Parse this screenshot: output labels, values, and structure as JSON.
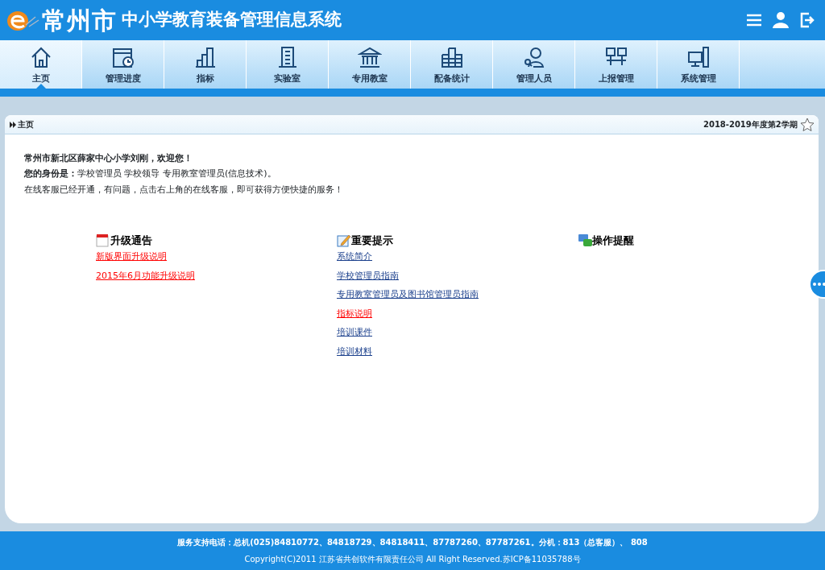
{
  "header": {
    "logo_text": "常州市",
    "title": "中小学教育装备管理信息系统"
  },
  "tabs": [
    {
      "label": "主页",
      "selected": true
    },
    {
      "label": "管理进度",
      "selected": false
    },
    {
      "label": "指标",
      "selected": false
    },
    {
      "label": "实验室",
      "selected": false
    },
    {
      "label": "专用教室",
      "selected": false
    },
    {
      "label": "配备统计",
      "selected": false
    },
    {
      "label": "管理人员",
      "selected": false
    },
    {
      "label": "上报管理",
      "selected": false
    },
    {
      "label": "系统管理",
      "selected": false
    }
  ],
  "breadcrumb": "主页",
  "term": "2018-2019年度第2学期",
  "welcome": {
    "greeting": "常州市新北区薛家中心小学刘刚，欢迎您！",
    "identity": "**您的身份是：**学校管理员 学校领导 专用教室管理员(信息技术)。",
    "notice": "在线客服已经开通，有问题，点击右上角的在线客服，即可获得方便快捷的服务！"
  },
  "sections": [
    {
      "title": "升级通告",
      "links": [
        {
          "text": "新版界面升级说明",
          "color": "#ff0000"
        },
        {
          "text": "2015年6月功能升级说明",
          "color": "#ff0000"
        }
      ]
    },
    {
      "title": "重要提示",
      "links": [
        {
          "text": "系统简介",
          "color": "#1a3f8c"
        },
        {
          "text": "学校管理员指南",
          "color": "#1a3f8c"
        },
        {
          "text": "专用教室管理员及图书馆管理员指南",
          "color": "#1a3f8c"
        },
        {
          "text": "指标说明",
          "color": "#ff0000"
        },
        {
          "text": "培训课件",
          "color": "#1a3f8c"
        },
        {
          "text": "培训材料",
          "color": "#1a3f8c"
        }
      ]
    },
    {
      "title": "操作提醒"
    }
  ],
  "footer": {
    "phone": "服务支持电话：总机(025)84810772、84818729、84818411、87787260、87787261。分机：813（总客服）、 808",
    "copyright": "Copyright(C)2011 江苏省共创软件有限责任公司 All Right Reserved.苏ICP备11035788号"
  }
}
